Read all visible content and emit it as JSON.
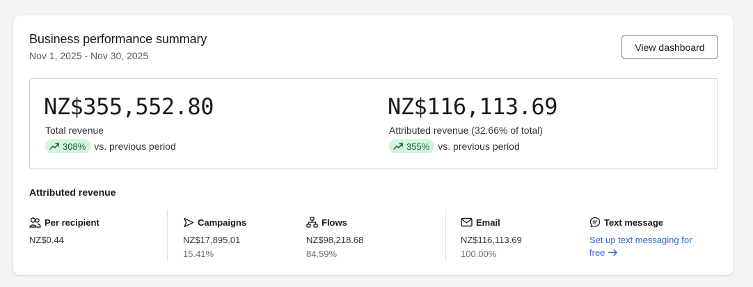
{
  "header": {
    "title": "Business performance summary",
    "date_range": "Nov 1, 2025 - Nov 30, 2025",
    "view_button": "View dashboard"
  },
  "summary": {
    "total": {
      "value": "NZ$355,552.80",
      "label": "Total revenue",
      "delta": "308%",
      "delta_suffix": "vs. previous period"
    },
    "attributed": {
      "value": "NZ$116,113.69",
      "label": "Attributed revenue (32.66% of total)",
      "delta": "355%",
      "delta_suffix": "vs. previous period"
    }
  },
  "attributed_section": {
    "title": "Attributed revenue",
    "per_recipient": {
      "label": "Per recipient",
      "value": "NZ$0.44",
      "icon": "users-icon"
    },
    "campaigns": {
      "label": "Campaigns",
      "value": "NZ$17,895.01",
      "pct": "15.41%",
      "icon": "send-icon"
    },
    "flows": {
      "label": "Flows",
      "value": "NZ$98,218.68",
      "pct": "84.59%",
      "icon": "flows-icon"
    },
    "email": {
      "label": "Email",
      "value": "NZ$116,113.69",
      "pct": "100.00%",
      "icon": "mail-icon"
    },
    "text_message": {
      "label": "Text message",
      "link": "Set up text messaging for free",
      "icon": "message-icon"
    }
  },
  "colors": {
    "badge_bg": "#d3f5dd",
    "badge_text": "#1b5e2f",
    "link": "#2a67c9"
  }
}
